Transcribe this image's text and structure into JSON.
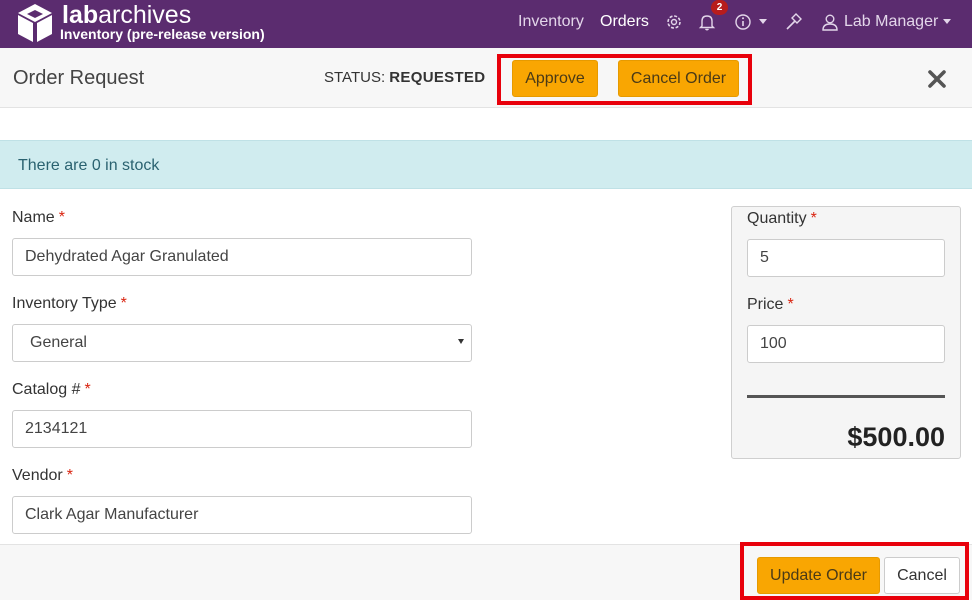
{
  "navbar": {
    "brand_bold": "lab",
    "brand_rest": "archives",
    "brand_sub": "Inventory (pre-release version)",
    "links": {
      "inventory": "Inventory",
      "orders": "Orders"
    },
    "notification_count": "2",
    "user": "Lab Manager",
    "icons": [
      "logo-cube-icon",
      "gear-icon",
      "bell-icon",
      "info-icon",
      "hammer-icon",
      "user-icon",
      "chevron-down-icon"
    ]
  },
  "modal": {
    "title": "Order Request",
    "status_label": "STATUS:",
    "status_value": "REQUESTED",
    "approve_label": "Approve",
    "cancel_order_label": "Cancel Order"
  },
  "alert": {
    "text": "There are 0 in stock"
  },
  "form": {
    "name": {
      "label": "Name",
      "value": "Dehydrated Agar Granulated",
      "required": "*"
    },
    "inventory_type": {
      "label": "Inventory Type",
      "value": "General",
      "required": "*"
    },
    "catalog": {
      "label": "Catalog #",
      "value": "2134121",
      "required": "*"
    },
    "vendor": {
      "label": "Vendor",
      "value": "Clark Agar Manufacturer",
      "required": "*"
    }
  },
  "pricing": {
    "quantity": {
      "label": "Quantity",
      "value": "5",
      "required": "*"
    },
    "price": {
      "label": "Price",
      "value": "100",
      "required": "*"
    },
    "total": "$500.00"
  },
  "footer": {
    "update_label": "Update Order",
    "cancel_label": "Cancel"
  },
  "colors": {
    "navbar": "#5b2c6f",
    "warning_button": "#f9a602",
    "alert_bg": "#d0ecef",
    "highlight": "#e8000b",
    "required": "#d9230f"
  }
}
